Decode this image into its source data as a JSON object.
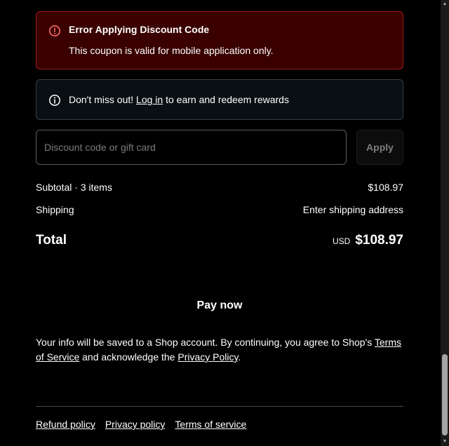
{
  "error_alert": {
    "title": "Error Applying Discount Code",
    "message": "This coupon is valid for mobile application only.",
    "icon": "alert-circle-icon",
    "color": "#a31a1a"
  },
  "info_alert": {
    "prefix": "Don't miss out! ",
    "link": "Log in",
    "suffix": " to earn and redeem rewards",
    "icon": "info-circle-icon"
  },
  "discount": {
    "placeholder": "Discount code or gift card",
    "value": "",
    "apply_label": "Apply"
  },
  "summary": {
    "subtotal_label": "Subtotal · 3 items",
    "subtotal_value": "$108.97",
    "shipping_label": "Shipping",
    "shipping_value": "Enter shipping address",
    "total_label": "Total",
    "currency": "USD",
    "total_value": "$108.97"
  },
  "pay_label": "Pay now",
  "legal": {
    "text1": "Your info will be saved to a Shop account. By continuing, you agree to Shop's ",
    "terms_link": "Terms of Service",
    "text2": " and acknowledge the ",
    "privacy_link": "Privacy Policy",
    "text3": "."
  },
  "footer": {
    "refund": "Refund policy",
    "privacy": "Privacy policy",
    "terms": "Terms of service"
  }
}
